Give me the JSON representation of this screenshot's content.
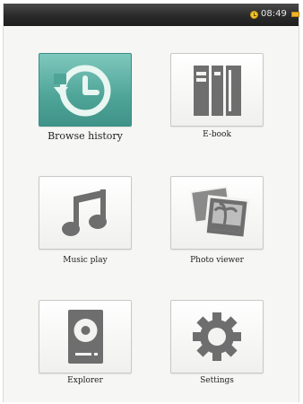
{
  "status_bar": {
    "time": "08:49",
    "icons": [
      "clock-icon",
      "battery-icon"
    ]
  },
  "menu": {
    "items": [
      {
        "label": "Browse history",
        "icon": "history-icon",
        "selected": true
      },
      {
        "label": "E-book",
        "icon": "book-icon",
        "selected": false
      },
      {
        "label": "Music play",
        "icon": "music-note-icon",
        "selected": false
      },
      {
        "label": "Photo viewer",
        "icon": "photo-icon",
        "selected": false
      },
      {
        "label": "Explorer",
        "icon": "hard-drive-icon",
        "selected": false
      },
      {
        "label": "Settings",
        "icon": "gear-icon",
        "selected": false
      }
    ]
  },
  "colors": {
    "status_bar": "#2a2a2a",
    "selected_tile": "#4fa498",
    "icon_gray": "#6e6e6e",
    "background": "#f6f6f4"
  }
}
